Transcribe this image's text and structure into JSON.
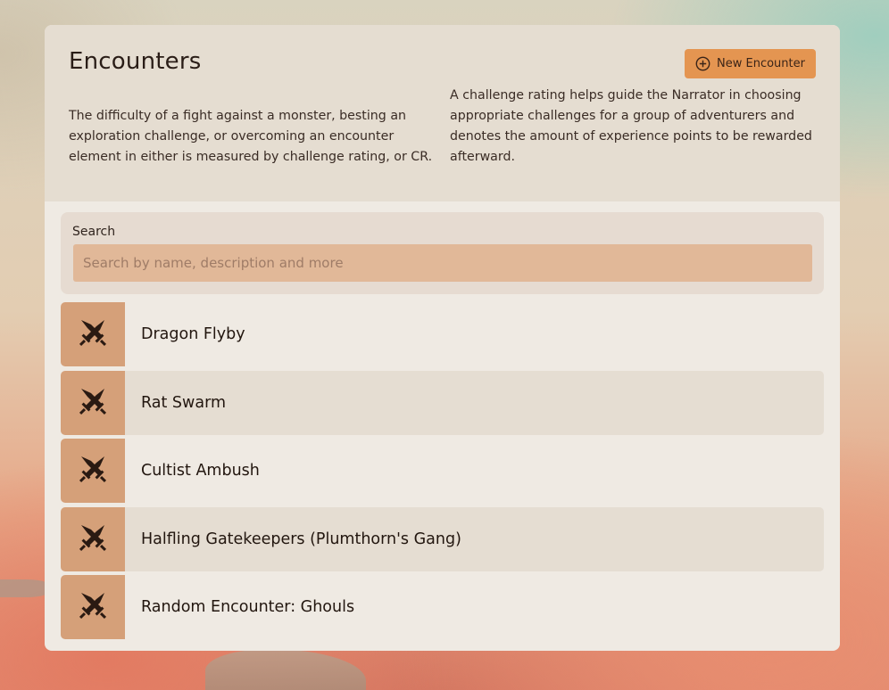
{
  "header": {
    "title": "Encounters",
    "new_button_label": "New Encounter",
    "new_button_icon": "plus-circle-icon",
    "description_left": "The difficulty of a fight against a monster, besting an exploration challenge, or overcoming an encounter element in either is measured by challenge rating, or CR.",
    "description_right": "A challenge rating helps guide the Narrator in choosing appropriate challenges for a group of adventurers and denotes the amount of experience points to be rewarded afterward."
  },
  "search": {
    "label": "Search",
    "placeholder": "Search by name, description and more",
    "value": ""
  },
  "encounters": [
    {
      "name": "Dragon Flyby",
      "icon": "crossed-swords-icon"
    },
    {
      "name": "Rat Swarm",
      "icon": "crossed-swords-icon"
    },
    {
      "name": "Cultist Ambush",
      "icon": "crossed-swords-icon"
    },
    {
      "name": "Halfling Gatekeepers (Plumthorn's Gang)",
      "icon": "crossed-swords-icon"
    },
    {
      "name": "Random Encounter: Ghouls",
      "icon": "crossed-swords-icon"
    }
  ],
  "colors": {
    "accent": "#e49551",
    "icon_tile": "#d5a079",
    "search_field": "#e1b898",
    "card": "#efeae3",
    "header_band": "#e5ddd1",
    "text": "#22160f"
  }
}
